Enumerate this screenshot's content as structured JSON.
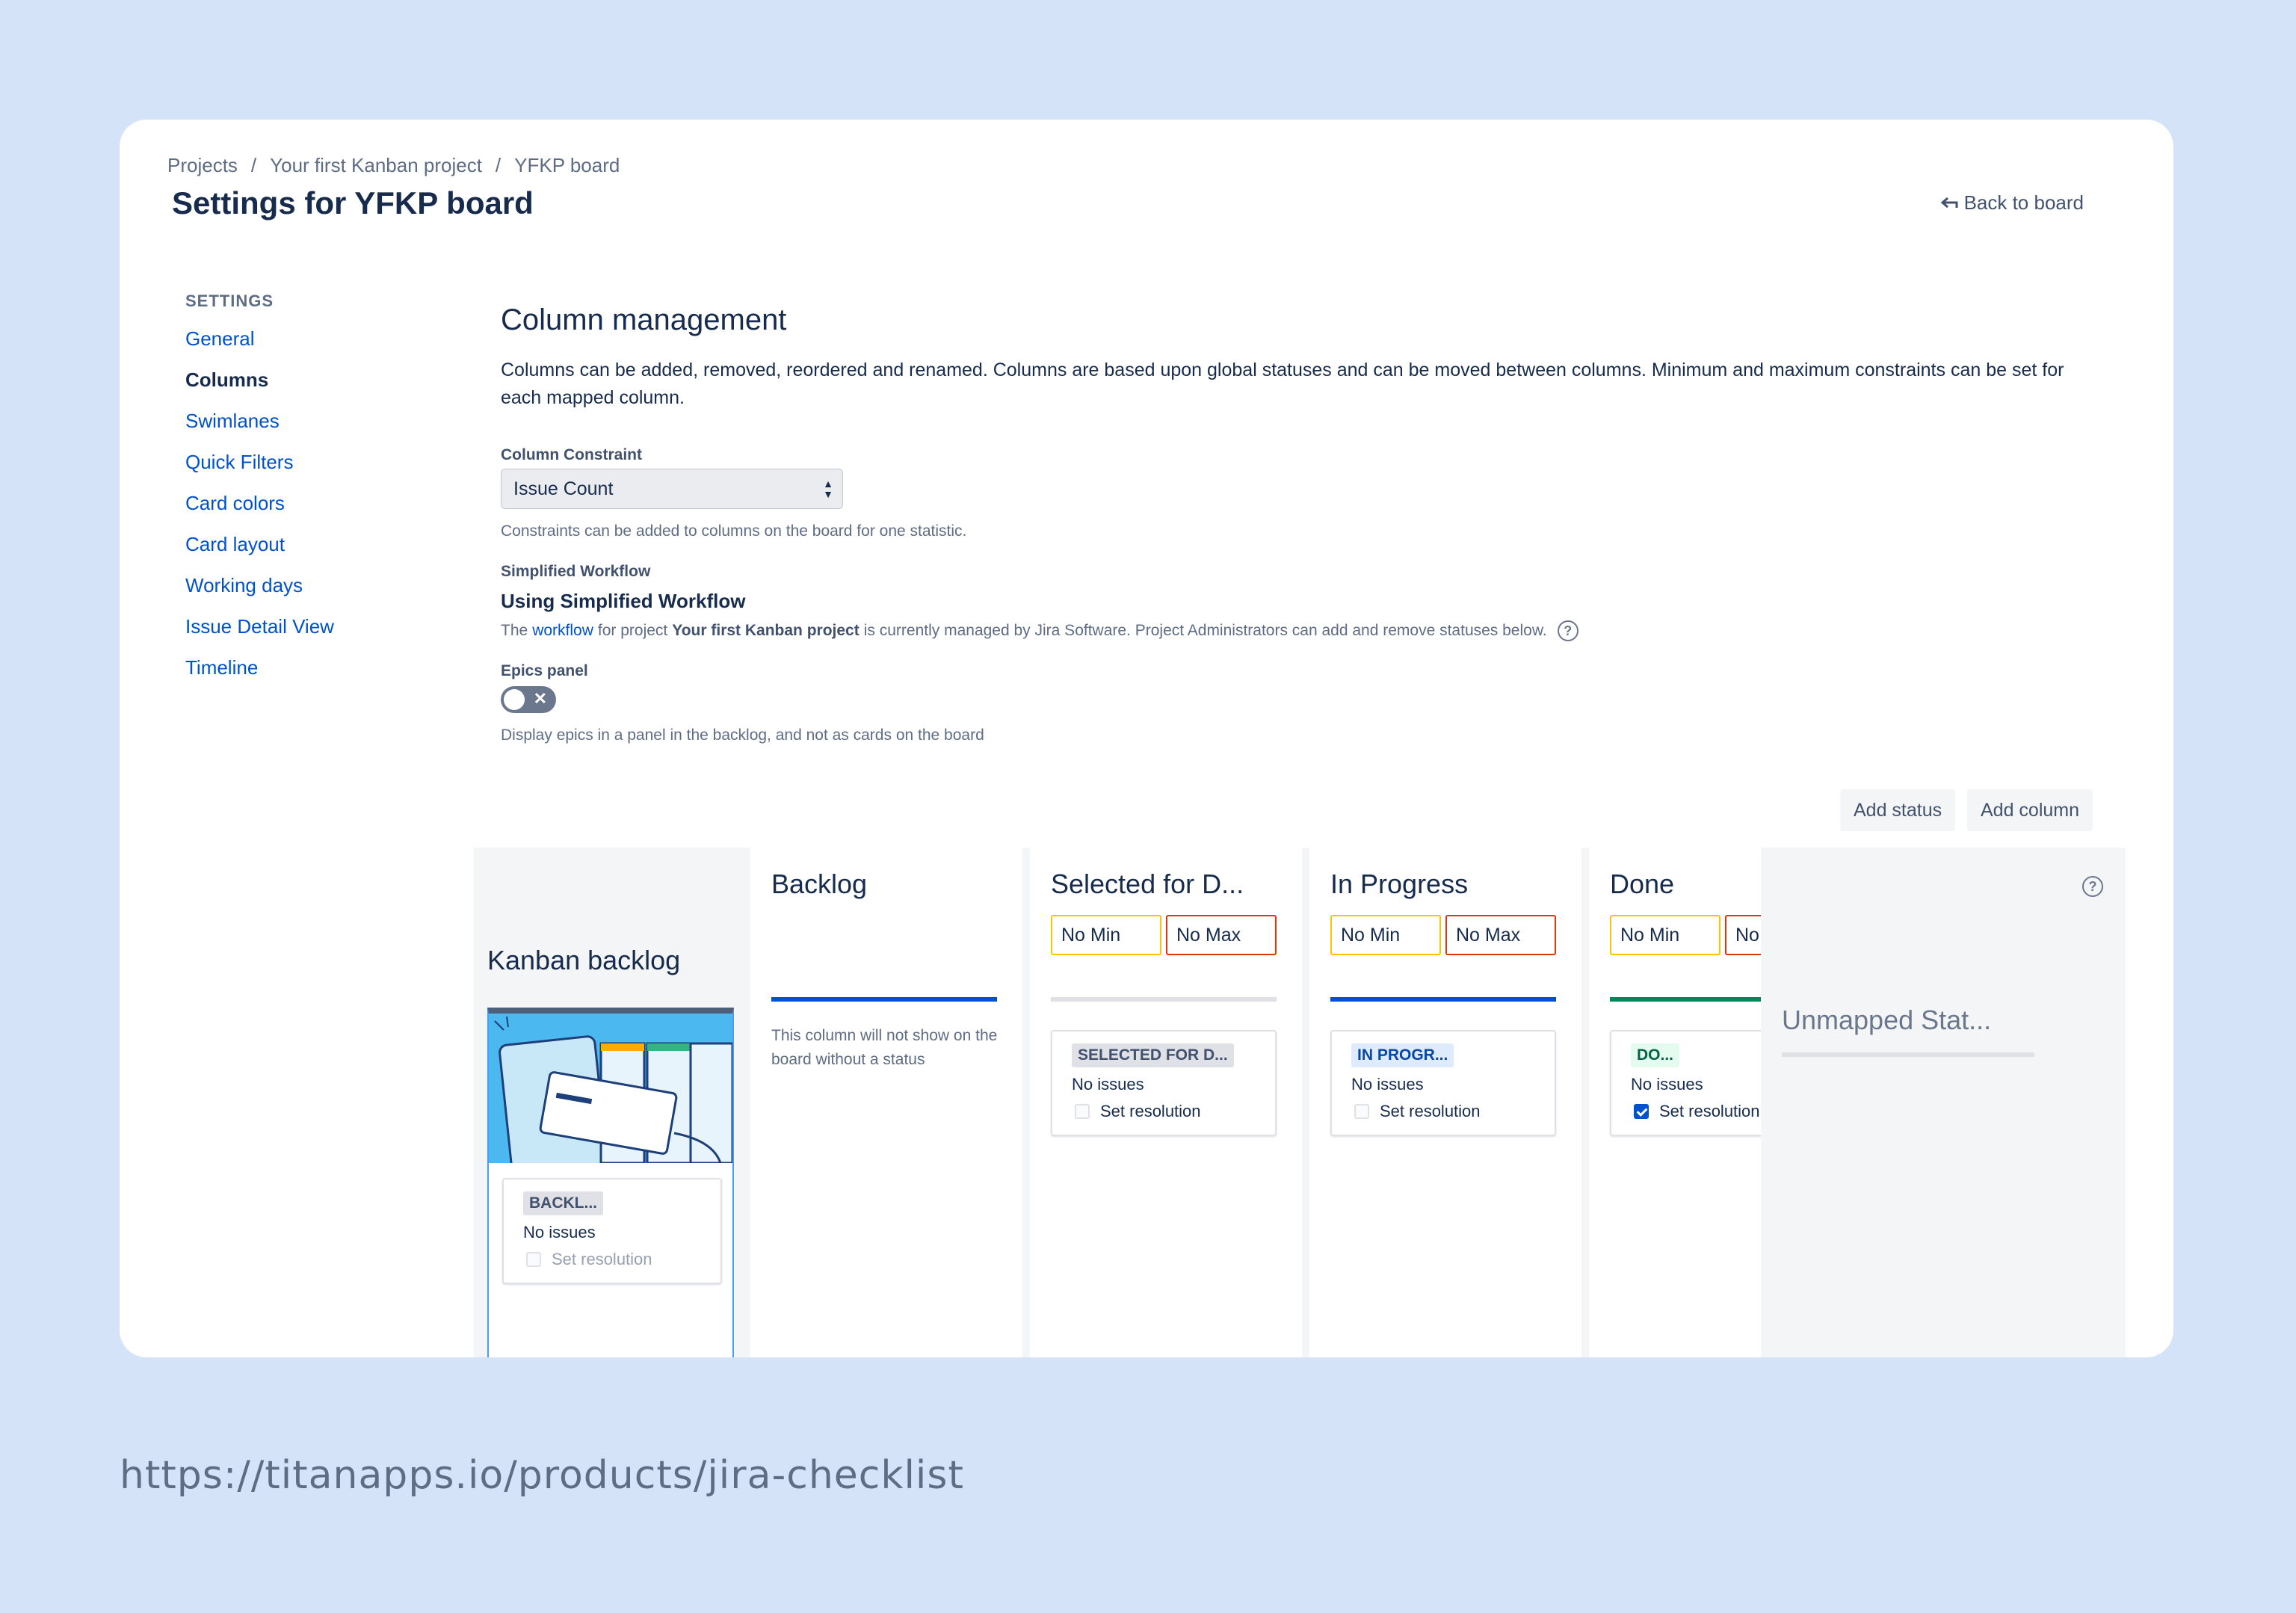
{
  "breadcrumb": [
    "Projects",
    "Your first Kanban project",
    "YFKP board"
  ],
  "breadcrumb_sep": "/",
  "page_title": "Settings for YFKP board",
  "back_link": "Back to board",
  "sidebar": {
    "heading": "SETTINGS",
    "items": [
      {
        "label": "General",
        "active": false
      },
      {
        "label": "Columns",
        "active": true
      },
      {
        "label": "Swimlanes",
        "active": false
      },
      {
        "label": "Quick Filters",
        "active": false
      },
      {
        "label": "Card colors",
        "active": false
      },
      {
        "label": "Card layout",
        "active": false
      },
      {
        "label": "Working days",
        "active": false
      },
      {
        "label": "Issue Detail View",
        "active": false
      },
      {
        "label": "Timeline",
        "active": false
      }
    ]
  },
  "main": {
    "title": "Column management",
    "description": "Columns can be added, removed, reordered and renamed. Columns are based upon global statuses and can be moved between columns. Minimum and maximum constraints can be set for each mapped column.",
    "constraint_label": "Column Constraint",
    "constraint_value": "Issue Count",
    "constraint_hint": "Constraints can be added to columns on the board for one statistic.",
    "workflow_label": "Simplified Workflow",
    "workflow_heading": "Using Simplified Workflow",
    "workflow_info_pre": "The",
    "workflow_info_link": "workflow",
    "workflow_info_mid": "for project",
    "workflow_info_project": "Your first Kanban project",
    "workflow_info_post": "is currently managed by Jira Software. Project Administrators can add and remove statuses below.",
    "help_glyph": "?",
    "epics_label": "Epics panel",
    "epics_toggle_on": false,
    "epics_toggle_glyph": "✕",
    "epics_hint": "Display epics in a panel in the backlog, and not as cards on the board",
    "add_status": "Add status",
    "add_column": "Add column"
  },
  "board": {
    "kanban_backlog": {
      "title": "Kanban backlog",
      "status": "BACKL...",
      "no_issues": "No issues",
      "set_resolution": "Set resolution"
    },
    "backlog": {
      "title": "Backlog",
      "note": "This column will not show on the board without a status"
    },
    "columns": [
      {
        "title": "Selected for D...",
        "min": "No Min",
        "max": "No Max",
        "status": "SELECTED FOR D...",
        "no_issues": "No issues",
        "set_resolution": "Set resolution",
        "checked": false,
        "bar_color": "#dfe1e6",
        "lozenge_bg": "#dfe1e6",
        "lozenge_fg": "#42526e"
      },
      {
        "title": "In Progress",
        "min": "No Min",
        "max": "No Max",
        "status": "IN PROGR...",
        "no_issues": "No issues",
        "set_resolution": "Set resolution",
        "checked": false,
        "bar_color": "#0052cc",
        "lozenge_bg": "#deebff",
        "lozenge_fg": "#0747a6"
      },
      {
        "title": "Done",
        "min": "No Min",
        "max": "No Max",
        "status": "DO...",
        "no_issues": "No issues",
        "set_resolution": "Set resolution",
        "checked": true,
        "bar_color": "#00875a",
        "lozenge_bg": "#e3fcef",
        "lozenge_fg": "#006644"
      }
    ],
    "unmapped_title": "Unmapped Stat..."
  },
  "footer_url": "https://titanapps.io/products/jira-checklist",
  "colors": {
    "background": "#d4e3f8",
    "link": "#0052cc",
    "text": "#172b4d"
  }
}
